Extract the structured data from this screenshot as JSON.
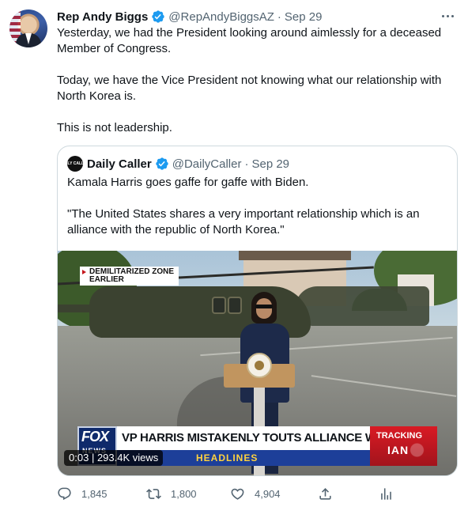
{
  "tweet": {
    "author_name": "Rep Andy Biggs",
    "handle": "@RepAndyBiggsAZ",
    "separator": "·",
    "date": "Sep 29",
    "paragraphs": [
      "Yesterday, we had the President looking around aimlessly for a deceased Member of Congress.",
      "Today, we have the Vice President not knowing what our relationship with North Korea is.",
      "This is not leadership."
    ]
  },
  "quote": {
    "avatar_text": "DAILY CALLER",
    "author_name": "Daily Caller",
    "handle": "@DailyCaller",
    "separator": "·",
    "date": "Sep 29",
    "paragraphs": [
      "Kamala Harris goes gaffe for gaffe with Biden.",
      "\"The United States shares a very important relationship which is an alliance with the republic of North Korea.\""
    ],
    "video": {
      "location_line1": "DEMILITARIZED ZONE",
      "location_line2": "EARLIER",
      "fox_logo": "FOX",
      "fox_sub": "NEWS",
      "headline": "VP HARRIS MISTAKENLY TOUTS ALLIANCE W/ NORTH KOREA",
      "subbar": "HEADLINES",
      "tracking_line1": "TRACKING",
      "tracking_line2": "IAN",
      "elapsed": "0:03",
      "views": "293.4K views"
    }
  },
  "actions": {
    "reply_count": "1,845",
    "retweet_count": "1,800",
    "like_count": "4,904"
  },
  "colors": {
    "verified": "#1d9bf0",
    "secondary_text": "#536471",
    "border": "#cfd9de"
  },
  "icons": [
    "more-icon",
    "verified-badge-icon",
    "reply-icon",
    "retweet-icon",
    "like-icon",
    "share-icon",
    "analytics-icon"
  ]
}
